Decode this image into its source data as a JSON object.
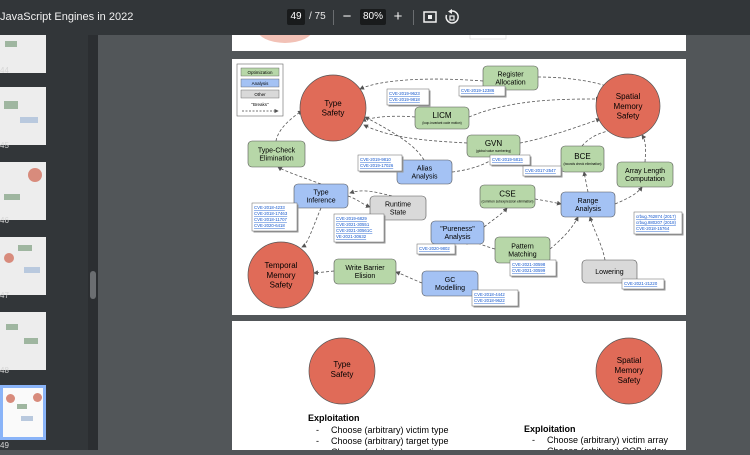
{
  "toolbar": {
    "title": "JavaScript Engines in 2022",
    "page_current": "49",
    "page_total": "/ 75",
    "zoom": "80%",
    "minus_label": "−",
    "plus_label": "+"
  },
  "sidebar": {
    "page_numbers": [
      "44",
      "45",
      "46",
      "47",
      "48",
      "49"
    ]
  },
  "legend": {
    "optimization": "Optimization",
    "analysis": "Analysis",
    "other": "Other",
    "breaks": "\"Breaks\""
  },
  "colors": {
    "red_node": "#e06b58",
    "green_node": "#b7d7a8",
    "blue_node": "#a4c2f4",
    "gray_node": "#d9d9d9",
    "link": "#1155cc"
  },
  "diagram": {
    "nodes": {
      "type_safety": "Type\nSafety",
      "spatial_memory_safety": "Spatial\nMemory\nSafety",
      "temporal_memory_safety": "Temporal\nMemory\nSafety",
      "register_allocation": "Register\nAllocation",
      "licm": "LICM",
      "licm_sub": "(loop-invariant code motion)",
      "gvn": "GVN",
      "gvn_sub": "(global value numbering)",
      "bce": "BCE",
      "bce_sub": "(bounds check elimination)",
      "type_check_elimination": "Type-Check\nElimination",
      "alias_analysis": "Alias\nAnalysis",
      "array_length_computation": "Array Length\nComputation",
      "cse": "CSE",
      "cse_sub": "(common subexpression elimination)",
      "type_inference": "Type\nInference",
      "runtime_state": "Runtime\nState",
      "range_analysis": "Range\nAnalysis",
      "pureness_analysis": "\"Pureness\"\nAnalysis",
      "pattern_matching": "Pattern\nMatching",
      "write_barrier_elision": "Write Barrier\nElision",
      "gc_modelling": "GC\nModelling",
      "lowering": "Lowering"
    },
    "cves": {
      "licm": [
        "CVE-2019-9623",
        "CVE-2019-9818"
      ],
      "register_allocation": [
        "CVE-2019-12386"
      ],
      "gvn": [
        "CVE-2019-5815"
      ],
      "alias_analysis": [
        "CVE-2019-9810",
        "CVE-2019-17026"
      ],
      "bce": [
        "CVE-2017-2547"
      ],
      "type_inference": [
        "CVE-2018-4233",
        "CVE-2018-17463",
        "CVE-2018-11707",
        "CVE-2020-6418"
      ],
      "runtime_state": [
        "CVE-2019-6829",
        "CVE-2021-30551",
        "CVE-2021-30561C",
        "VE-2021-30632"
      ],
      "range_analysis": [
        "crbug.762874 (2017)",
        "crbug.880207 (2018)",
        "CVE-2018-15764"
      ],
      "pureness_analysis": [
        "CVE-2020-9802"
      ],
      "pattern_matching": [
        "CVE-2021-30598",
        "CVE-2021-30599"
      ],
      "gc_modelling": [
        "CVE-2018-4442",
        "CVE-2018-9622"
      ],
      "lowering": [
        "CVE-2021-21220"
      ]
    }
  },
  "next_page": {
    "type_safety": "Type\nSafety",
    "spatial_memory_safety": "Spatial\nMemory\nSafety",
    "exploitation_left_heading": "Exploitation",
    "exploitation_left": [
      "Choose (arbitrary) victim type",
      "Choose (arbitrary) target type",
      "Choose (arbitrary) operation"
    ],
    "exploitation_right_heading": "Exploitation",
    "exploitation_right": [
      "Choose (arbitrary) victim array",
      "Choose (arbitrary) OOB index"
    ]
  }
}
